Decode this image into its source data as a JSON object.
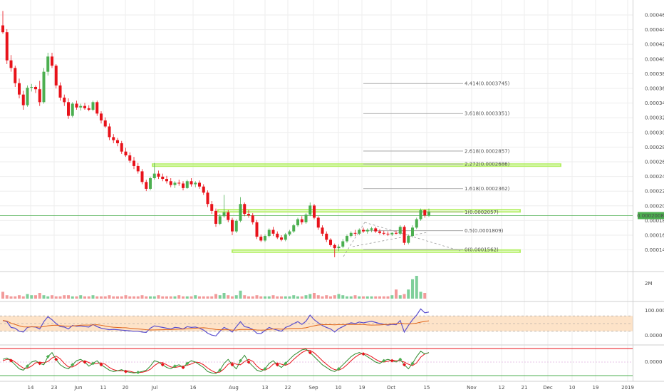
{
  "colors": {
    "up": "#4caf50",
    "down": "#e8121a",
    "neutral": "#9c78c9",
    "grid": "#eeeeee",
    "fib_line": "#9a9a9a",
    "zone": "#b6f06a",
    "hline": "#4caf50",
    "rsi_line": "#5a4fcf",
    "rsi_ma": "#e0651a",
    "rsi_band": "#fde3c8",
    "stoch_k": "#2e8b2e",
    "stoch_d": "#e8121a",
    "last_label_bg": "#4caf50"
  },
  "price_axis": {
    "ticks": [
      "0.0004600",
      "0.0004400",
      "0.0004200",
      "0.0004000",
      "0.0003800",
      "0.0003600",
      "0.0003400",
      "0.0003200",
      "0.0003000",
      "0.0002800",
      "0.0002600",
      "0.0002400",
      "0.0002200",
      "0.0002000",
      "0.0001800",
      "0.0001600",
      "0.0001400"
    ],
    "last_price_label": "0.0002008"
  },
  "volume_axis": {
    "label": "2M"
  },
  "rsi_axis": {
    "upper": "100.0000",
    "lower": "0.0000"
  },
  "stoch_axis": {
    "zero": "0.0000"
  },
  "time_axis": {
    "labels": [
      "14",
      "23",
      "Jun",
      "11",
      "20",
      "Jul",
      "16",
      "Aug",
      "13",
      "22",
      "Sep",
      "10",
      "19",
      "Oct",
      "15",
      "Nov",
      "12",
      "21",
      "Dec",
      "10",
      "19",
      "2019"
    ]
  },
  "fib_levels": [
    {
      "label": "4.414(0.0003745)"
    },
    {
      "label": "3.618(0.0003351)"
    },
    {
      "label": "2.618(0.0002857)"
    },
    {
      "label": "2.272(0.0002686)"
    },
    {
      "label": "1.618(0.0002362)"
    },
    {
      "label": "1(0.0002057)"
    },
    {
      "label": "0.5(0.0001809)"
    },
    {
      "label": "0(0.0001562)"
    }
  ],
  "chart_data": {
    "type": "candlestick",
    "price_ylim": [
      0.00013,
      0.000475
    ],
    "ohlc": [
      [
        0.000451,
        0.00047,
        0.00044,
        0.000442
      ],
      [
        0.000442,
        0.000446,
        0.0004,
        0.000405
      ],
      [
        0.000405,
        0.000412,
        0.00039,
        0.000395
      ],
      [
        0.000395,
        0.000398,
        0.00037,
        0.000375
      ],
      [
        0.000375,
        0.000381,
        0.000355,
        0.00036
      ],
      [
        0.00036,
        0.000365,
        0.00034,
        0.000346
      ],
      [
        0.000346,
        0.000372,
        0.000344,
        0.000369
      ],
      [
        0.000369,
        0.000374,
        0.000364,
        0.00037
      ],
      [
        0.00037,
        0.000372,
        0.000362,
        0.000367
      ],
      [
        0.000367,
        0.000378,
        0.000345,
        0.00035
      ],
      [
        0.00035,
        0.000395,
        0.000348,
        0.00039
      ],
      [
        0.00039,
        0.000415,
        0.000385,
        0.00041
      ],
      [
        0.00041,
        0.000415,
        0.000395,
        0.000398
      ],
      [
        0.000398,
        0.0004,
        0.000368,
        0.000372
      ],
      [
        0.000372,
        0.000376,
        0.000352,
        0.000356
      ],
      [
        0.000356,
        0.00036,
        0.000345,
        0.00035
      ],
      [
        0.00035,
        0.000355,
        0.000328,
        0.000332
      ],
      [
        0.000332,
        0.00035,
        0.00033,
        0.000348
      ],
      [
        0.000348,
        0.000352,
        0.00034,
        0.000343
      ],
      [
        0.000343,
        0.000348,
        0.000339,
        0.000345
      ],
      [
        0.000345,
        0.000349,
        0.00034,
        0.000342
      ],
      [
        0.000342,
        0.000346,
        0.000338,
        0.00034
      ],
      [
        0.00034,
        0.000352,
        0.000338,
        0.00035
      ],
      [
        0.00035,
        0.000352,
        0.000332,
        0.000335
      ],
      [
        0.000335,
        0.000338,
        0.000322,
        0.000326
      ],
      [
        0.000326,
        0.00033,
        0.000316,
        0.000318
      ],
      [
        0.000318,
        0.000322,
        0.0003,
        0.000304
      ],
      [
        0.000304,
        0.000308,
        0.000296,
        0.0003
      ],
      [
        0.0003,
        0.000303,
        0.000292,
        0.000296
      ],
      [
        0.000296,
        0.000299,
        0.000282,
        0.000285
      ],
      [
        0.000285,
        0.00029,
        0.000278,
        0.00028
      ],
      [
        0.00028,
        0.000284,
        0.00027,
        0.000273
      ],
      [
        0.000273,
        0.000278,
        0.000262,
        0.000266
      ],
      [
        0.000266,
        0.00027,
        0.000256,
        0.000259
      ],
      [
        0.000259,
        0.000262,
        0.000242,
        0.000245
      ],
      [
        0.000245,
        0.000248,
        0.000233,
        0.000236
      ],
      [
        0.000236,
        0.000252,
        0.000234,
        0.00025
      ],
      [
        0.00025,
        0.00027,
        0.000248,
        0.000256
      ],
      [
        0.000256,
        0.00026,
        0.000249,
        0.000252
      ],
      [
        0.000252,
        0.000256,
        0.000246,
        0.000249
      ],
      [
        0.000249,
        0.000253,
        0.000243,
        0.000246
      ],
      [
        0.000246,
        0.00025,
        0.000238,
        0.000241
      ],
      [
        0.000241,
        0.000246,
        0.000237,
        0.000244
      ],
      [
        0.000244,
        0.000248,
        0.00024,
        0.000243
      ],
      [
        0.000243,
        0.000246,
        0.000234,
        0.000237
      ],
      [
        0.000237,
        0.000248,
        0.000236,
        0.000246
      ],
      [
        0.000246,
        0.00025,
        0.000239,
        0.000242
      ],
      [
        0.000242,
        0.000246,
        0.000238,
        0.000244
      ],
      [
        0.000244,
        0.000247,
        0.000236,
        0.000239
      ],
      [
        0.000239,
        0.000242,
        0.000228,
        0.000231
      ],
      [
        0.000231,
        0.000234,
        0.000212,
        0.000216
      ],
      [
        0.000216,
        0.00022,
        0.000203,
        0.000207
      ],
      [
        0.000207,
        0.00021,
        0.000186,
        0.00019
      ],
      [
        0.00019,
        0.000203,
        0.000188,
        0.0002
      ],
      [
        0.0002,
        0.000228,
        0.000198,
        0.000205
      ],
      [
        0.000205,
        0.000208,
        0.000192,
        0.000195
      ],
      [
        0.000195,
        0.000198,
        0.000175,
        0.00018
      ],
      [
        0.00018,
        0.000196,
        0.000178,
        0.000194
      ],
      [
        0.000194,
        0.000225,
        0.000192,
        0.000216
      ],
      [
        0.000216,
        0.000218,
        0.0002,
        0.000203
      ],
      [
        0.000203,
        0.000208,
        0.000198,
        0.000201
      ],
      [
        0.000201,
        0.000204,
        0.000189,
        0.000192
      ],
      [
        0.000192,
        0.000195,
        0.00017,
        0.000173
      ],
      [
        0.000173,
        0.000176,
        0.000166,
        0.000168
      ],
      [
        0.000168,
        0.000176,
        0.000166,
        0.000174
      ],
      [
        0.000174,
        0.000184,
        0.000172,
        0.000182
      ],
      [
        0.000182,
        0.000186,
        0.000174,
        0.000177
      ],
      [
        0.000177,
        0.00018,
        0.00017,
        0.000172
      ],
      [
        0.000172,
        0.000175,
        0.000167,
        0.000169
      ],
      [
        0.000169,
        0.000178,
        0.000167,
        0.000176
      ],
      [
        0.000176,
        0.000182,
        0.000174,
        0.00018
      ],
      [
        0.00018,
        0.00019,
        0.000178,
        0.000188
      ],
      [
        0.000188,
        0.000198,
        0.000186,
        0.000196
      ],
      [
        0.000196,
        0.0002,
        0.000189,
        0.000192
      ],
      [
        0.000192,
        0.000204,
        0.00019,
        0.000202
      ],
      [
        0.000202,
        0.000218,
        0.0002,
        0.000214
      ],
      [
        0.000214,
        0.000216,
        0.000196,
        0.000198
      ],
      [
        0.000198,
        0.0002,
        0.000182,
        0.000185
      ],
      [
        0.000185,
        0.000188,
        0.000174,
        0.000177
      ],
      [
        0.000177,
        0.00018,
        0.000166,
        0.000169
      ],
      [
        0.000169,
        0.000171,
        0.00016,
        0.000162
      ],
      [
        0.000162,
        0.000164,
        0.000146,
        0.000158
      ],
      [
        0.000158,
        0.000163,
        0.000154,
        0.00016
      ],
      [
        0.00016,
        0.00017,
        0.000158,
        0.000167
      ],
      [
        0.000167,
        0.000176,
        0.000165,
        0.000174
      ],
      [
        0.000174,
        0.00018,
        0.000172,
        0.000178
      ],
      [
        0.000178,
        0.000182,
        0.000174,
        0.000177
      ],
      [
        0.000177,
        0.000184,
        0.000175,
        0.000182
      ],
      [
        0.000182,
        0.000185,
        0.000178,
        0.00018
      ],
      [
        0.00018,
        0.000184,
        0.000177,
        0.000182
      ],
      [
        0.000182,
        0.000186,
        0.000179,
        0.000184
      ],
      [
        0.000184,
        0.000186,
        0.000178,
        0.00018
      ],
      [
        0.00018,
        0.000183,
        0.000176,
        0.000178
      ],
      [
        0.000178,
        0.000181,
        0.000175,
        0.000177
      ],
      [
        0.000177,
        0.00018,
        0.000174,
        0.000176
      ],
      [
        0.000176,
        0.000179,
        0.000174,
        0.000178
      ],
      [
        0.000178,
        0.000181,
        0.000176,
        0.000177
      ],
      [
        0.000177,
        0.000188,
        0.000175,
        0.000186
      ],
      [
        0.000186,
        0.000188,
        0.000162,
        0.000165
      ],
      [
        0.000165,
        0.000176,
        0.000163,
        0.000174
      ],
      [
        0.000174,
        0.000188,
        0.000172,
        0.000185
      ],
      [
        0.000185,
        0.000198,
        0.000183,
        0.000196
      ],
      [
        0.000196,
        0.00021,
        0.000194,
        0.000208
      ],
      [
        0.000208,
        0.000209,
        0.000198,
        0.000201
      ],
      [
        0.000201,
        0.00021,
        0.000199,
        0.000206
      ]
    ],
    "volume": [
      0.6,
      0.3,
      0.2,
      0.2,
      0.3,
      0.2,
      0.4,
      0.3,
      0.3,
      0.5,
      0.3,
      0.2,
      0.3,
      0.2,
      0.2,
      0.3,
      0.3,
      0.2,
      0.2,
      0.3,
      0.2,
      0.2,
      0.3,
      0.2,
      0.2,
      0.2,
      0.3,
      0.2,
      0.2,
      0.2,
      0.3,
      0.2,
      0.2,
      0.2,
      0.3,
      0.2,
      0.2,
      0.2,
      0.3,
      0.2,
      0.2,
      0.2,
      0.2,
      0.3,
      0.2,
      0.2,
      0.2,
      0.3,
      0.2,
      0.2,
      0.2,
      0.2,
      0.4,
      0.3,
      0.5,
      0.3,
      0.2,
      0.3,
      0.7,
      0.3,
      0.2,
      0.2,
      0.3,
      0.2,
      0.2,
      0.2,
      0.3,
      0.2,
      0.2,
      0.2,
      0.2,
      0.3,
      0.2,
      0.2,
      0.3,
      0.4,
      0.5,
      0.3,
      0.2,
      0.3,
      0.2,
      0.3,
      0.4,
      0.3,
      0.2,
      0.2,
      0.3,
      0.2,
      0.2,
      0.2,
      0.2,
      0.2,
      0.2,
      0.2,
      0.2,
      0.3,
      0.8,
      0.3,
      0.4,
      0.8,
      1.7,
      2.0,
      0.6,
      0.5
    ],
    "rsi": [
      58,
      55,
      40,
      38,
      30,
      28,
      40,
      42,
      41,
      36,
      55,
      68,
      60,
      50,
      42,
      41,
      36,
      45,
      43,
      44,
      42,
      41,
      48,
      42,
      38,
      36,
      34,
      35,
      34,
      33,
      32,
      31,
      30,
      30,
      28,
      27,
      38,
      44,
      42,
      40,
      38,
      36,
      40,
      39,
      36,
      42,
      40,
      41,
      38,
      33,
      25,
      20,
      18,
      30,
      40,
      35,
      28,
      42,
      55,
      42,
      40,
      35,
      25,
      24,
      32,
      40,
      36,
      33,
      30,
      40,
      44,
      50,
      55,
      48,
      56,
      72,
      60,
      52,
      45,
      40,
      36,
      28,
      37,
      42,
      48,
      52,
      50,
      54,
      52,
      54,
      56,
      53,
      50,
      48,
      46,
      48,
      47,
      58,
      28,
      45,
      60,
      72,
      88,
      78,
      80
    ],
    "rsi_band": [
      70,
      30
    ],
    "stoch_k": [
      60,
      65,
      55,
      40,
      25,
      20,
      35,
      50,
      55,
      45,
      40,
      70,
      85,
      60,
      40,
      30,
      25,
      40,
      55,
      60,
      50,
      35,
      45,
      55,
      40,
      30,
      20,
      15,
      18,
      22,
      15,
      12,
      10,
      12,
      15,
      20,
      35,
      55,
      50,
      40,
      30,
      25,
      35,
      40,
      30,
      45,
      55,
      50,
      40,
      30,
      15,
      10,
      8,
      20,
      45,
      60,
      40,
      25,
      55,
      75,
      50,
      35,
      20,
      15,
      25,
      45,
      55,
      40,
      30,
      45,
      60,
      75,
      85,
      95,
      98,
      85,
      70,
      55,
      40,
      30,
      20,
      15,
      25,
      40,
      55,
      70,
      80,
      85,
      80,
      70,
      60,
      50,
      45,
      55,
      60,
      55,
      50,
      60,
      40,
      25,
      45,
      70,
      90,
      80,
      85
    ],
    "stoch_d": [
      55,
      60,
      60,
      50,
      38,
      28,
      27,
      35,
      47,
      50,
      47,
      52,
      65,
      72,
      62,
      45,
      32,
      32,
      40,
      52,
      55,
      48,
      43,
      45,
      47,
      42,
      30,
      22,
      18,
      18,
      18,
      16,
      12,
      11,
      12,
      16,
      23,
      37,
      47,
      48,
      40,
      32,
      30,
      33,
      35,
      38,
      43,
      50,
      48,
      40,
      28,
      18,
      11,
      13,
      25,
      42,
      48,
      42,
      40,
      52,
      60,
      53,
      35,
      23,
      20,
      28,
      42,
      47,
      42,
      38,
      45,
      60,
      73,
      85,
      93,
      93,
      84,
      70,
      55,
      42,
      30,
      22,
      20,
      27,
      40,
      55,
      68,
      78,
      82,
      78,
      70,
      60,
      52,
      50,
      53,
      57,
      55,
      55,
      50,
      42,
      37,
      47,
      68,
      80,
      85
    ]
  }
}
